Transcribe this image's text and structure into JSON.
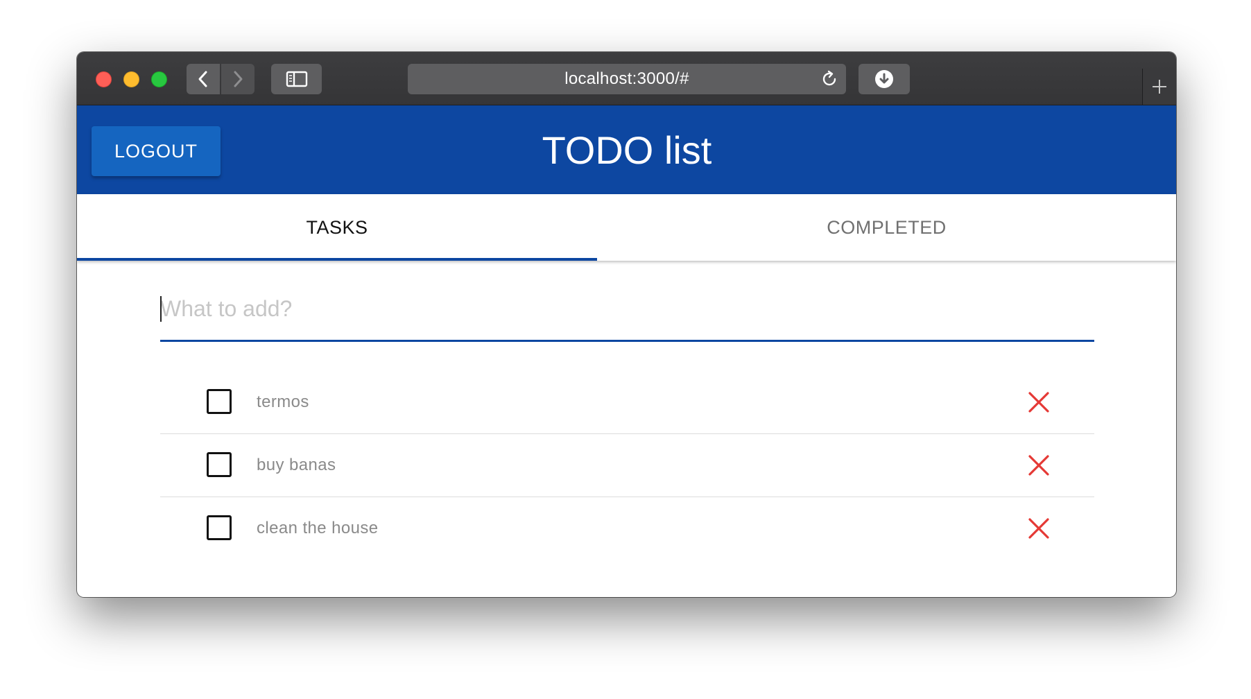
{
  "browser": {
    "url": "localhost:3000/#",
    "icons": {
      "back": "chevron-left-icon",
      "forward": "chevron-right-icon",
      "sidebar": "sidebar-icon",
      "reload": "reload-icon",
      "download": "download-icon",
      "new_tab": "plus-icon"
    }
  },
  "appbar": {
    "logout_label": "LOGOUT",
    "title": "TODO list",
    "color": "#0d47a1",
    "button_color": "#1565c0"
  },
  "tabs": [
    {
      "label": "TASKS",
      "active": true
    },
    {
      "label": "COMPLETED",
      "active": false
    }
  ],
  "new_task": {
    "placeholder": "What to add?",
    "value": ""
  },
  "tasks": [
    {
      "label": "termos",
      "checked": false
    },
    {
      "label": "buy banas",
      "checked": false
    },
    {
      "label": "clean the house",
      "checked": false
    }
  ],
  "colors": {
    "delete_icon": "#e53935",
    "accent": "#0d47a1"
  }
}
